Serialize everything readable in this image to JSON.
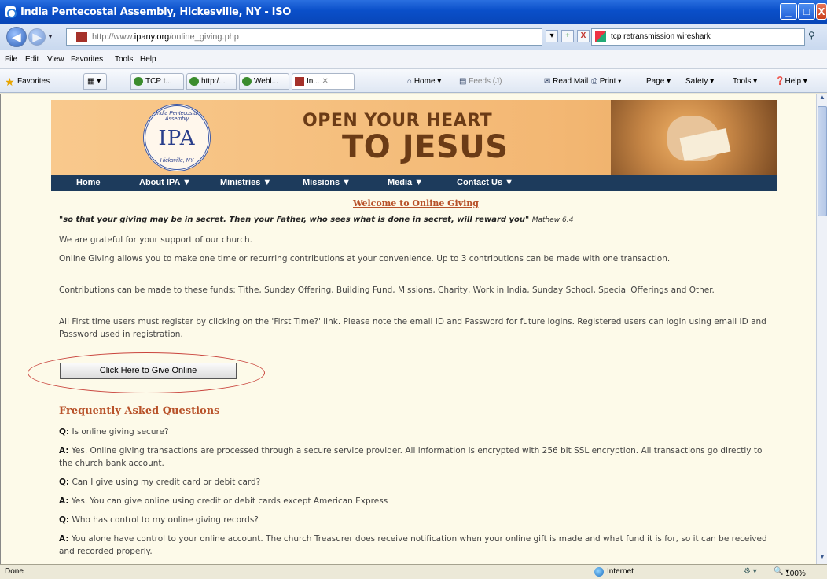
{
  "window": {
    "title": "India Pentecostal Assembly, Hickesville, NY - ISO",
    "min_label": "_",
    "max_label": "□",
    "close_label": "X"
  },
  "address": {
    "url_prefix": "http://www.",
    "url_domain": "ipany.org",
    "url_path": "/online_giving.php",
    "search_query": "tcp retransmission wireshark",
    "refresh_label": "+",
    "stop_label": "X"
  },
  "menu": [
    "File",
    "Edit",
    "View",
    "Favorites",
    "Tools",
    "Help"
  ],
  "favorites": {
    "label": "Favorites",
    "tabs": [
      "TCP t...",
      "http:/...",
      "Webl...",
      "In..."
    ],
    "commands": [
      "Home",
      "Feeds (J)",
      "Read Mail",
      "Print",
      "Page",
      "Safety",
      "Tools",
      "Help"
    ]
  },
  "banner": {
    "seal_text": "IPA",
    "seal_ring_top": "India Pentecostal Assembly",
    "seal_ring_bottom": "Hicksville, NY",
    "slogan_line1": "OPEN YOUR HEART",
    "slogan_line2": "TO JESUS"
  },
  "nav": [
    "Home",
    "About IPA ▼",
    "Ministries ▼",
    "Missions ▼",
    "Media ▼",
    "Contact Us ▼"
  ],
  "content": {
    "welcome": "Welcome to Online Giving",
    "quote": "\"so that your giving may be in secret. Then your Father, who sees what is done in secret, will reward you\"",
    "quote_ref": "Mathew 6:4",
    "para1": "We are grateful for your support of our church.",
    "para2": "Online Giving allows you to make one time or recurring contributions at your convenience. Up to 3 contributions can be made with one transaction.",
    "para3": "Contributions can be made to these funds: Tithe, Sunday Offering, Building Fund, Missions, Charity, Work in India, Sunday School, Special Offerings and Other.",
    "para4": "All First time users must register by clicking on the 'First Time?' link. Please note the email ID and Password for future logins. Registered users can login using email ID and Password used in registration.",
    "give_button": "Click Here to Give Online",
    "faq_title": "Frequently Asked Questions",
    "q_label": "Q:",
    "a_label": "A:",
    "faqs": [
      {
        "q": "Is online giving secure?",
        "a": "Yes. Online giving transactions are processed through a secure service provider. All information is encrypted with 256 bit SSL encryption. All transactions go directly to the church bank account."
      },
      {
        "q": "Can I give using my credit card or debit card?",
        "a": "Yes. You can give online using credit or debit cards except American Express"
      },
      {
        "q": "Who has control to my online giving records?",
        "a": "You alone have control to your online account. The church Treasurer does receive notification when your online gift is made and what fund it is for, so it can be received and recorded properly."
      }
    ]
  },
  "status": {
    "left": "Done",
    "zone": "Internet",
    "zoom": "100%"
  }
}
